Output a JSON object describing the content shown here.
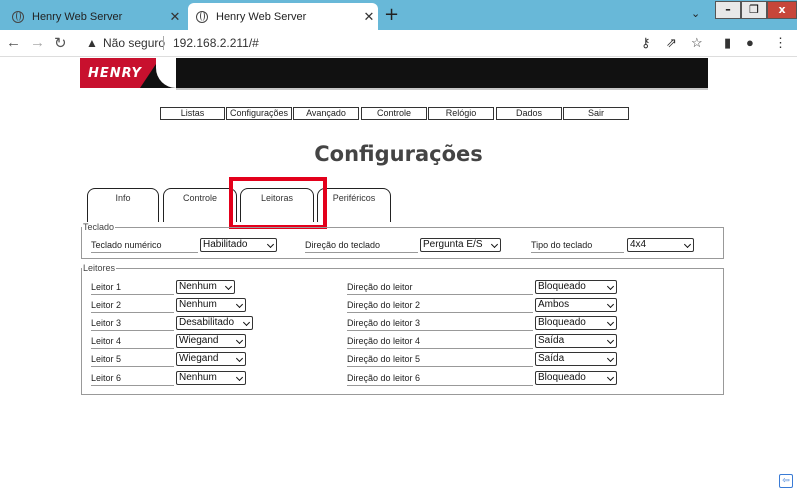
{
  "browser": {
    "tabs": [
      {
        "title": "Henry Web Server"
      },
      {
        "title": "Henry Web Server"
      }
    ],
    "new_tab": "+",
    "close": "✕",
    "address": {
      "security": "Não seguro",
      "url": "192.168.2.211/#"
    }
  },
  "window": {
    "minimize": "–",
    "maximize": "❐",
    "close": "x"
  },
  "logo": "HENRY",
  "menu": [
    "Listas",
    "Configurações",
    "Avançado",
    "Controle",
    "Relógio",
    "Dados",
    "Sair"
  ],
  "page_title": "Configurações",
  "page_tabs": [
    "Info",
    "Controle",
    "Leitoras",
    "Periféricos"
  ],
  "highlighted_tab": "Leitoras",
  "teclado": {
    "legend": "Teclado",
    "fields": [
      {
        "label": "Teclado numérico",
        "value": "Habilitado"
      },
      {
        "label": "Direção do teclado",
        "value": "Pergunta E/S"
      },
      {
        "label": "Tipo do teclado",
        "value": "4x4"
      }
    ]
  },
  "leitores": {
    "legend": "Leitores",
    "rows": [
      {
        "label": "Leitor 1",
        "value": "Nenhum",
        "dir_label": "Direção do leitor",
        "dir_value": "Bloqueado"
      },
      {
        "label": "Leitor 2",
        "value": "Nenhum",
        "dir_label": "Direção do leitor 2",
        "dir_value": "Ambos"
      },
      {
        "label": "Leitor 3",
        "value": "Desabilitado",
        "dir_label": "Direção do leitor 3",
        "dir_value": "Bloqueado"
      },
      {
        "label": "Leitor 4",
        "value": "Wiegand",
        "dir_label": "Direção do leitor 4",
        "dir_value": "Saída"
      },
      {
        "label": "Leitor 5",
        "value": "Wiegand",
        "dir_label": "Direção do leitor 5",
        "dir_value": "Saída"
      },
      {
        "label": "Leitor 6",
        "value": "Nenhum",
        "dir_label": "Direção do leitor 6",
        "dir_value": "Bloqueado"
      }
    ]
  }
}
